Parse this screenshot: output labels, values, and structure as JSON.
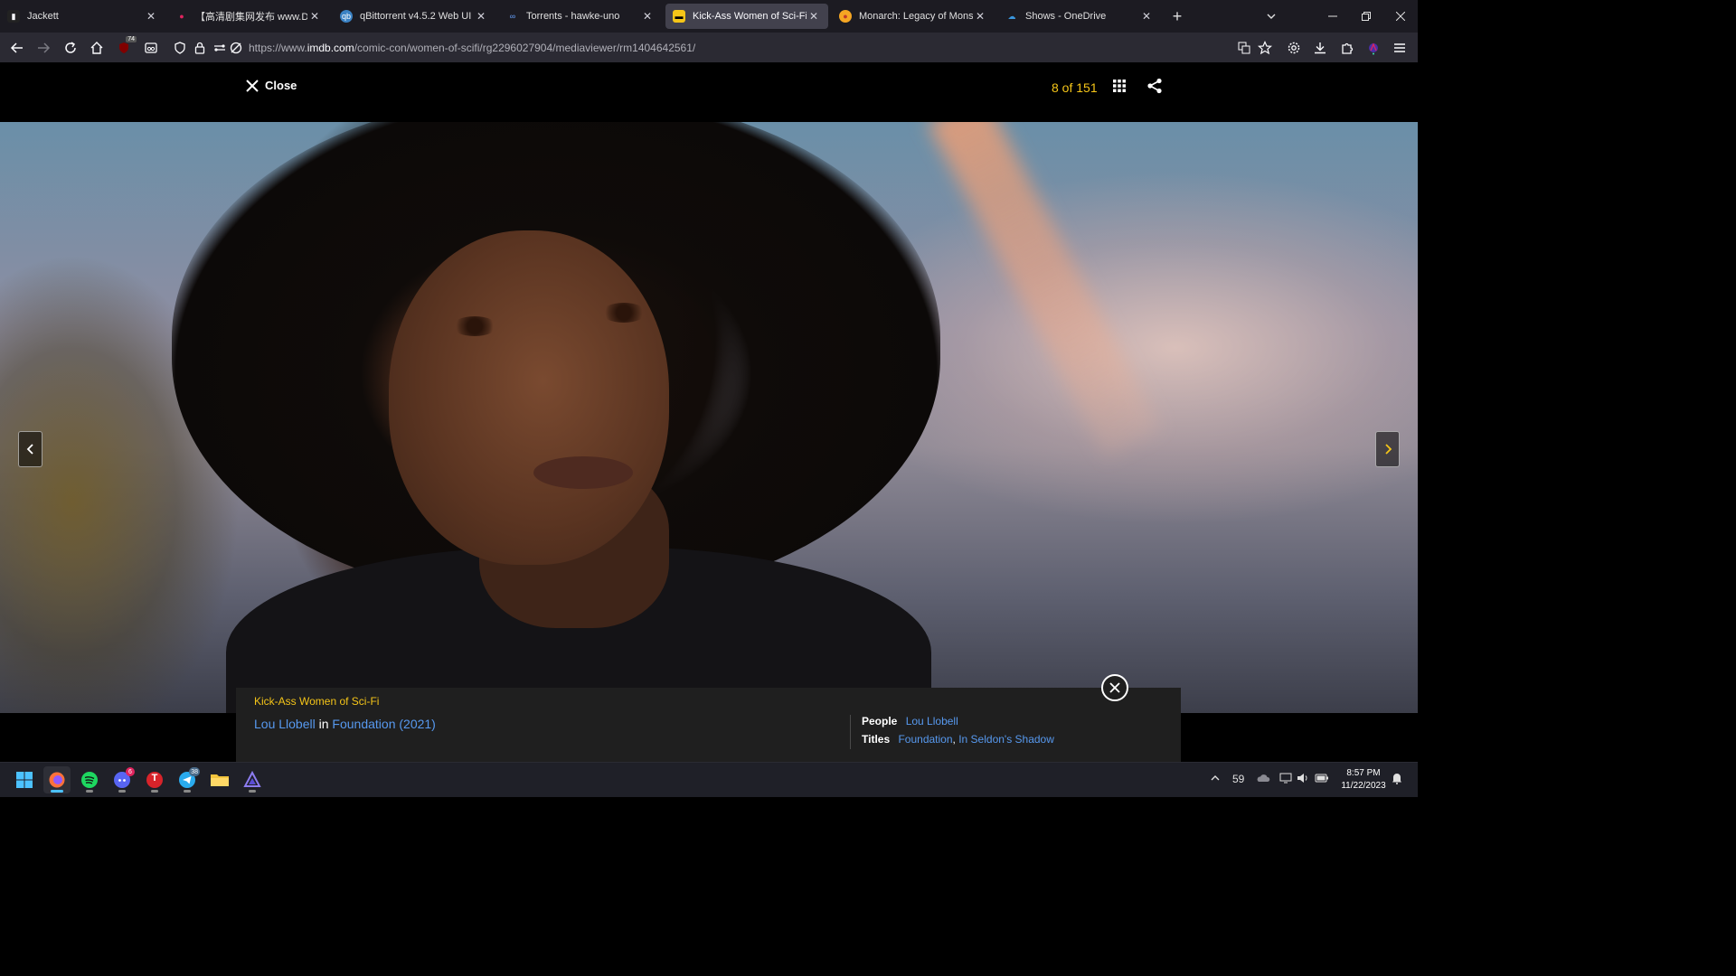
{
  "browser": {
    "tabs": [
      {
        "title": "Jackett",
        "active": false
      },
      {
        "title": "【高清剧集网发布 www.DDHDTV",
        "active": false
      },
      {
        "title": "qBittorrent v4.5.2 Web UI",
        "active": false
      },
      {
        "title": "Torrents - hawke-uno",
        "active": false
      },
      {
        "title": "Kick-Ass Women of Sci-Fi",
        "active": true
      },
      {
        "title": "Monarch: Legacy of Monsters (",
        "active": false
      },
      {
        "title": "Shows - OneDrive",
        "active": false
      }
    ],
    "new_tab_glyph": "+",
    "extension_badge": "74",
    "url": {
      "prefix": "https://www.",
      "domain": "imdb.com",
      "path": "/comic-con/women-of-scifi/rg2296027904/mediaviewer/rm1404642561/"
    }
  },
  "viewer": {
    "close_label": "Close",
    "counter": "8 of 151",
    "caption": {
      "gallery_title": "Kick-Ass Women of Sci-Fi",
      "person": "Lou Llobell",
      "connector": "in",
      "title": "Foundation (2021)",
      "people_label": "People",
      "people_value": "Lou Llobell",
      "titles_label": "Titles",
      "titles": [
        "Foundation",
        "In Seldon's Shadow"
      ],
      "titles_sep": ","
    }
  },
  "taskbar": {
    "apps": [
      {
        "name": "start",
        "icon": "windows-logo-icon"
      },
      {
        "name": "firefox",
        "icon": "firefox-icon",
        "active": true
      },
      {
        "name": "spotify",
        "icon": "spotify-icon"
      },
      {
        "name": "discord",
        "icon": "discord-icon",
        "badge": "6"
      },
      {
        "name": "t-app",
        "icon": "t-app-icon",
        "letter": "T"
      },
      {
        "name": "telegram",
        "icon": "telegram-icon",
        "badge": "38"
      },
      {
        "name": "file-explorer",
        "icon": "folder-icon"
      },
      {
        "name": "proton",
        "icon": "triangle-app-icon"
      }
    ],
    "tray_number": "59",
    "time": "8:57 PM",
    "date": "11/22/2023"
  },
  "colors": {
    "imdb_yellow": "#f5c518",
    "link_blue": "#5799ef",
    "tab_active": "#42414d",
    "toolbar": "#2b2a33",
    "taskbar": "#1f2028"
  }
}
